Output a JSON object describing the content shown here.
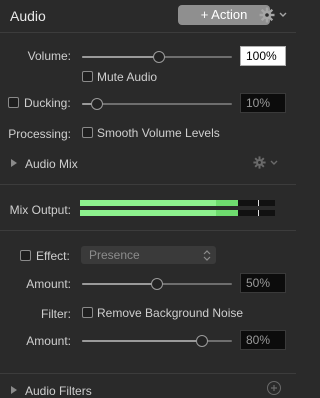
{
  "header": {
    "title": "Audio",
    "action_label": "+ Action"
  },
  "volume": {
    "label": "Volume:",
    "value": "100%",
    "level": 0.51
  },
  "mute": {
    "label": "Mute Audio",
    "checked": false
  },
  "ducking": {
    "label": "Ducking:",
    "value": "10%",
    "level": 0.1,
    "checked": false
  },
  "processing": {
    "label": "Processing:",
    "option_label": "Smooth Volume Levels",
    "checked": false
  },
  "audio_mix": {
    "label": "Audio Mix"
  },
  "mix_output": {
    "label": "Mix Output:",
    "level_left": 0.81,
    "level_right": 0.81
  },
  "effect": {
    "label": "Effect:",
    "select_value": "Presence",
    "checked": false
  },
  "effect_amount": {
    "label": "Amount:",
    "value": "50%",
    "level": 0.5
  },
  "filter": {
    "label": "Filter:",
    "option_label": "Remove Background Noise",
    "checked": false
  },
  "filter_amount": {
    "label": "Amount:",
    "value": "80%",
    "level": 0.8
  },
  "audio_filters": {
    "label": "Audio Filters"
  },
  "colors": {
    "meter_green": "#6fdc6f",
    "meter_bright": "#8df08d",
    "accent_field_bg": "#ffffff"
  }
}
